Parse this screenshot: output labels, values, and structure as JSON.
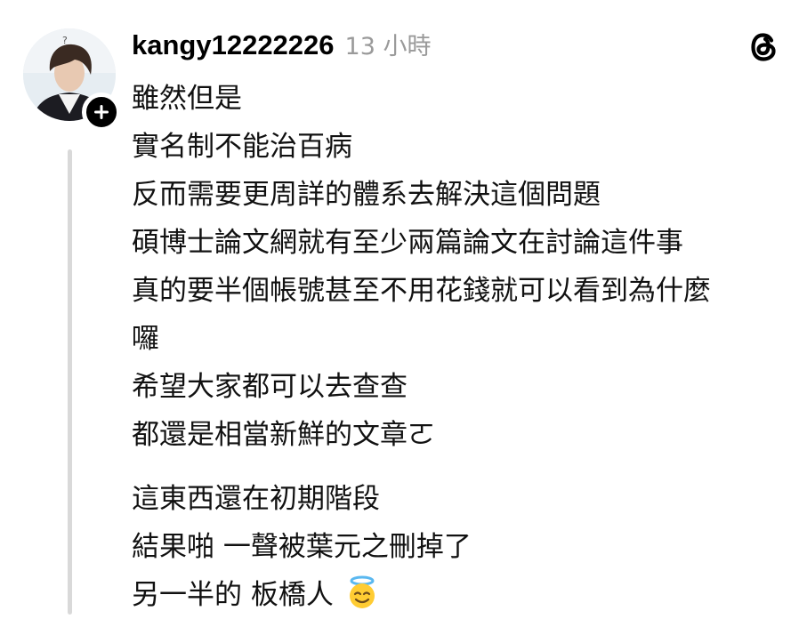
{
  "post": {
    "username": "kangy12222226",
    "timestamp": "13 小時",
    "lines_block1": [
      "雖然但是",
      "實名制不能治百病",
      "反而需要更周詳的體系去解決這個問題",
      "碩博士論文網就有至少兩篇論文在討論這件事",
      "真的要半個帳號甚至不用花錢就可以看到為什麼",
      "囉",
      "希望大家都可以去查查",
      "都還是相當新鮮的文章ㄛ"
    ],
    "lines_block2": [
      "這東西還在初期階段",
      "結果啪 一聲被葉元之刪掉了"
    ],
    "last_line": "另一半的 板橋人",
    "last_emoji": "smiling-face-with-halo-emoji"
  },
  "icons": {
    "follow": "plus-icon",
    "app": "threads-logo-icon"
  },
  "colors": {
    "text": "#111111",
    "muted": "#9a9a9a",
    "thread_line": "#d9d9d9"
  }
}
